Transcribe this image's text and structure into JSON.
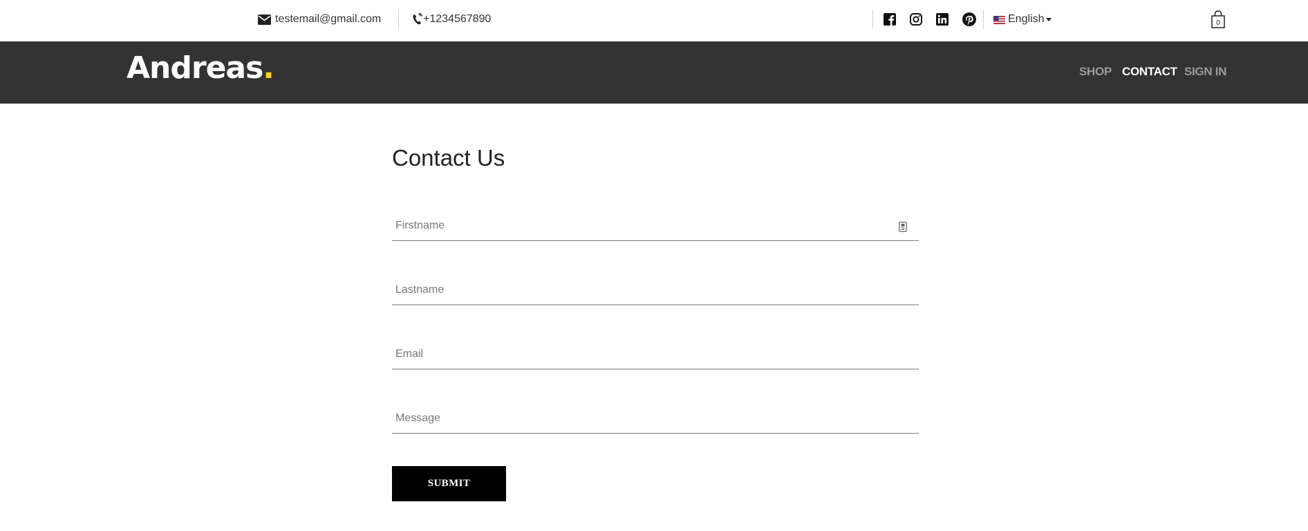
{
  "topbar": {
    "email": "testemail@gmail.com",
    "phone": "+1234567890",
    "language": "English",
    "cart_count": "0",
    "social_icons": [
      "facebook-icon",
      "instagram-icon",
      "linkedin-icon",
      "pinterest-icon"
    ]
  },
  "header": {
    "logo_text": "Andreas",
    "logo_dot": ".",
    "nav": [
      {
        "label": "SHOP",
        "active": false
      },
      {
        "label": "CONTACT",
        "active": true
      },
      {
        "label": "SIGN IN",
        "active": false
      }
    ]
  },
  "main": {
    "title": "Contact Us",
    "fields": {
      "firstname_placeholder": "Firstname",
      "lastname_placeholder": "Lastname",
      "email_placeholder": "Email",
      "message_placeholder": "Message"
    },
    "submit_label": "SUBMIT"
  },
  "colors": {
    "header_bg": "#333333",
    "accent": "#ffd21e",
    "nav_inactive": "#9b9b9b",
    "nav_active": "#ffffff",
    "submit_bg": "#000000"
  }
}
